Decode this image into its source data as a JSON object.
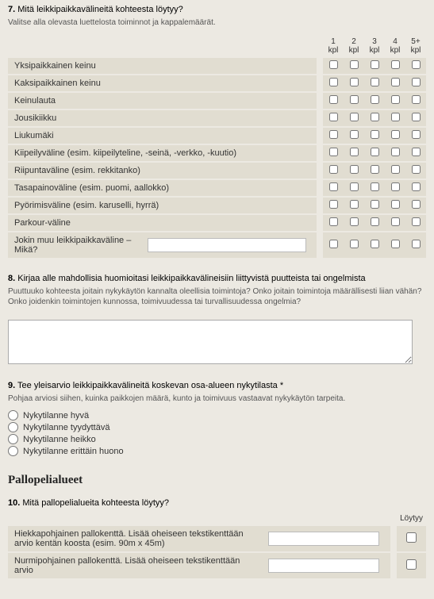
{
  "q7": {
    "number": "7.",
    "title": "Mitä leikkipaikkavälineitä kohteesta löytyy?",
    "hint": "Valitse alla olevasta luettelosta toiminnot ja kappalemäärät.",
    "columns": [
      "1\nkpl",
      "2\nkpl",
      "3\nkpl",
      "4\nkpl",
      "5+\nkpl"
    ],
    "rows": [
      "Yksipaikkainen keinu",
      "Kaksipaikkainen keinu",
      "Keinulauta",
      "Jousikiikku",
      "Liukumäki",
      "Kiipeilyväline (esim. kiipeilyteline, -seinä, -verkko, -kuutio)",
      "Riipuntaväline (esim. rekkitanko)",
      "Tasapainoväline (esim. puomi, aallokko)",
      "Pyörimisväline (esim. karuselli, hyrrä)",
      "Parkour-väline"
    ],
    "other_row_label": "Jokin muu leikkipaikkaväline – Mikä?",
    "other_value": ""
  },
  "q8": {
    "number": "8.",
    "title": "Kirjaa alle mahdollisia huomioitasi leikkipaikkavälineisiin liittyvistä puutteista tai ongelmista",
    "hint": "Puuttuuko kohteesta joitain nykykäytön kannalta oleellisia toimintoja? Onko joitain toimintoja määrällisesti liian vähän? Onko joidenkin toimintojen kunnossa, toimivuudessa tai turvallisuudessa ongelmia?",
    "value": ""
  },
  "q9": {
    "number": "9.",
    "title": "Tee yleisarvio leikkipaikkavälineitä koskevan osa-alueen nykytilasta",
    "required_marker": "*",
    "hint": "Pohjaa arviosi siihen, kuinka paikkojen määrä, kunto ja toimivuus vastaavat nykykäytön tarpeita.",
    "options": [
      "Nykytilanne hyvä",
      "Nykytilanne tyydyttävä",
      "Nykytilanne heikko",
      "Nykytilanne erittäin huono"
    ]
  },
  "section_ball": "Pallopelialueet",
  "q10": {
    "number": "10.",
    "title": "Mitä pallopelialueita kohteesta löytyy?",
    "col": "Löytyy",
    "rows": [
      "Hiekkapohjainen pallokenttä. Lisää oheiseen tekstikenttään arvio kentän koosta (esim. 90m x 45m)",
      "Nurmipohjainen pallokenttä. Lisää oheiseen tekstikenttään arvio"
    ],
    "values": [
      "",
      ""
    ]
  }
}
